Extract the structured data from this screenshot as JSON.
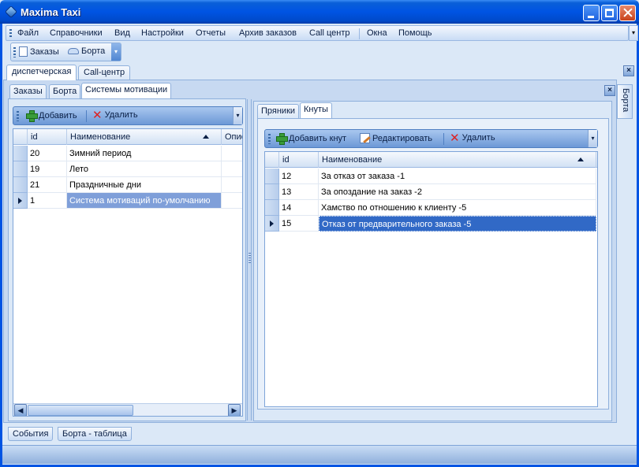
{
  "window": {
    "title": "Maxima Taxi"
  },
  "menu": [
    {
      "label": "Файл"
    },
    {
      "label": "Справочники"
    },
    {
      "label": "Вид"
    },
    {
      "label": "Настройки"
    },
    {
      "label": "Отчеты"
    },
    {
      "label": "Архив заказов"
    },
    {
      "label": "Call центр"
    },
    {
      "label": "Окна"
    },
    {
      "label": "Помощь"
    }
  ],
  "toolbar": {
    "orders": "Заказы",
    "cars": "Борта"
  },
  "top_tabs": [
    {
      "label": "диспетчерская",
      "active": true
    },
    {
      "label": "Call-центр",
      "active": false
    }
  ],
  "sub_tabs": [
    {
      "label": "Заказы"
    },
    {
      "label": "Борта"
    },
    {
      "label": "Системы мотивации",
      "active": true
    }
  ],
  "left_toolbar": {
    "add": "Добавить",
    "delete": "Удалить"
  },
  "left_grid": {
    "columns": [
      "id",
      "Наименование",
      "Описа"
    ],
    "rows": [
      {
        "id": "20",
        "name": "Зимний период"
      },
      {
        "id": "19",
        "name": "Лето"
      },
      {
        "id": "21",
        "name": "Праздничные дни"
      },
      {
        "id": "1",
        "name": "Система мотиваций по-умолчанию",
        "current": true
      }
    ]
  },
  "right_tabs": [
    {
      "label": "Пряники"
    },
    {
      "label": "Кнуты",
      "active": true
    }
  ],
  "right_toolbar": {
    "add": "Добавить кнут",
    "edit": "Редактировать",
    "delete": "Удалить"
  },
  "right_grid": {
    "columns": [
      "id",
      "Наименование"
    ],
    "rows": [
      {
        "id": "12",
        "name": "За отказ от заказа -1"
      },
      {
        "id": "13",
        "name": "За опоздание на заказ -2"
      },
      {
        "id": "14",
        "name": "Хамство по отношению к клиенту -5"
      },
      {
        "id": "15",
        "name": "Отказ от предварительного заказа -5",
        "current": true
      }
    ]
  },
  "side_tab": "Борта",
  "bottom_tabs": [
    {
      "label": "События"
    },
    {
      "label": "Борта - таблица"
    }
  ],
  "colors": {
    "titlebar": "#0054e3",
    "selection": "#3169c6",
    "frame": "#dbe8f7"
  }
}
